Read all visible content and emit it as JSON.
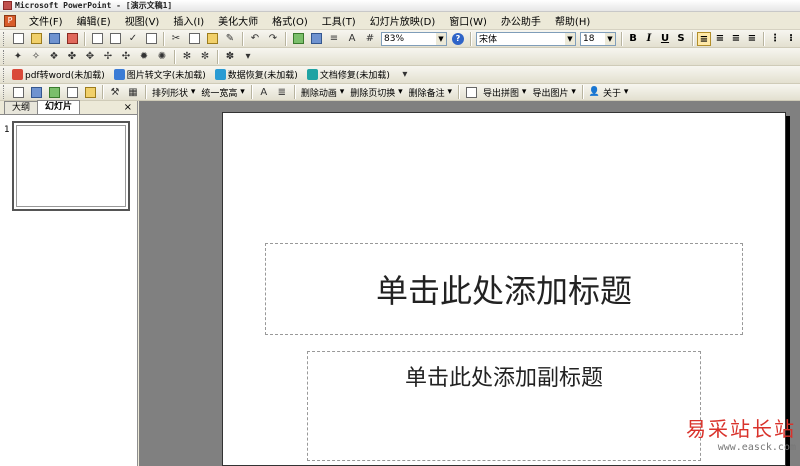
{
  "window": {
    "title": "Microsoft PowerPoint - [演示文稿1]"
  },
  "menu": [
    "文件(F)",
    "编辑(E)",
    "视图(V)",
    "插入(I)",
    "美化大师",
    "格式(O)",
    "工具(T)",
    "幻灯片放映(D)",
    "窗口(W)",
    "办公助手",
    "帮助(H)"
  ],
  "toolbar": {
    "zoom": "83%",
    "font": "宋体",
    "font_size": "18"
  },
  "format_buttons": [
    "B",
    "I",
    "U",
    "S"
  ],
  "addins": [
    {
      "label": "pdf转word(未加载)",
      "color": "#d94a3a"
    },
    {
      "label": "图片转文字(未加载)",
      "color": "#3a7bd5"
    },
    {
      "label": "数据恢复(未加载)",
      "color": "#2a9bd3"
    },
    {
      "label": "文档修复(未加载)",
      "color": "#1fa3a3"
    }
  ],
  "drawing_toolbar": {
    "arrange": "排列形状",
    "uniform": "统一宽高",
    "del_animation": "删除动画",
    "del_transition": "删除页切换",
    "del_notes": "删除备注",
    "export_puzzle": "导出拼图",
    "export_image": "导出图片",
    "about": "关于"
  },
  "panel": {
    "tab_outline": "大纲",
    "tab_slides": "幻灯片",
    "close": "×",
    "slide_number": "1"
  },
  "slide": {
    "title_placeholder": "单击此处添加标题",
    "subtitle_placeholder": "单击此处添加副标题"
  },
  "watermark": {
    "name": "易采站长站",
    "url": "www.easck.com"
  }
}
